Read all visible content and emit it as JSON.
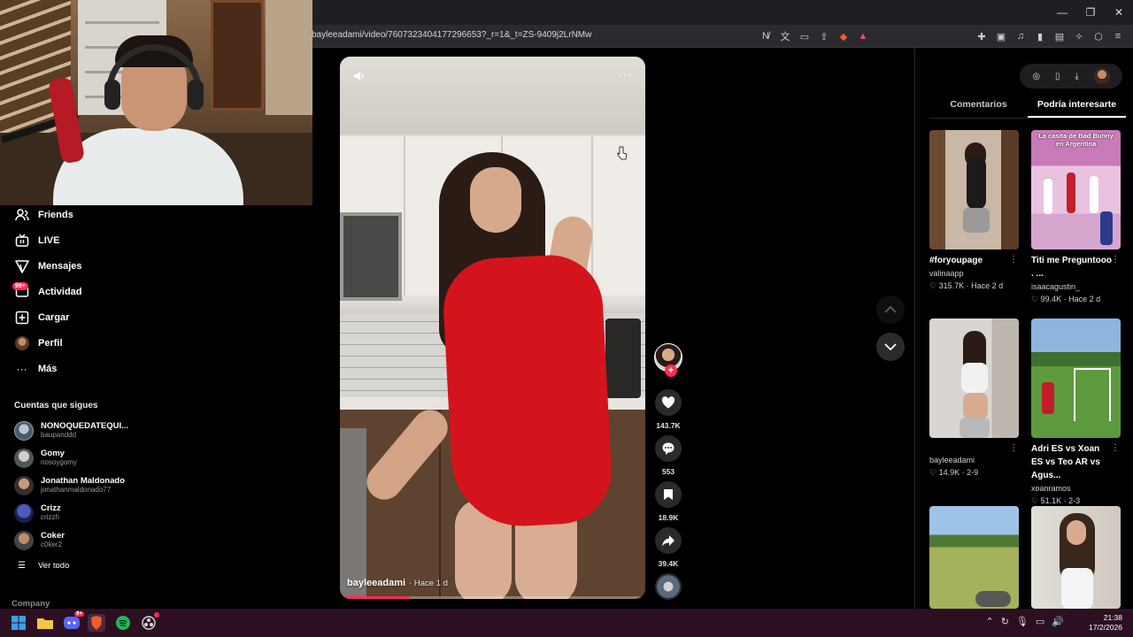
{
  "browser": {
    "url": "bayleeadami/video/7607323404177296653?_r=1&_t=ZS-9409j2LrNMw",
    "window_controls": [
      "—",
      "❐",
      "✕"
    ]
  },
  "sidebar": {
    "items": [
      {
        "label": "Friends",
        "icon": "friends-icon"
      },
      {
        "label": "LIVE",
        "icon": "live-icon"
      },
      {
        "label": "Mensajes",
        "icon": "messages-icon"
      },
      {
        "label": "Actividad",
        "icon": "activity-icon"
      },
      {
        "label": "Cargar",
        "icon": "upload-icon"
      },
      {
        "label": "Perfil",
        "icon": "profile-avatar"
      },
      {
        "label": "Más",
        "icon": "more-icon"
      }
    ],
    "activity_badge": "99+",
    "following_title": "Cuentas que sigues",
    "following": [
      {
        "name": "NONOQUEDATEQUI...",
        "handle": "baupanddd"
      },
      {
        "name": "Gomy",
        "handle": "nosoygomy"
      },
      {
        "name": "Jonathan Maldonado",
        "handle": "jonathanmaldonado77"
      },
      {
        "name": "Crizz",
        "handle": "crizzh"
      },
      {
        "name": "Coker",
        "handle": "c0ker2"
      }
    ],
    "see_all": "Ver todo",
    "company": "Company"
  },
  "video": {
    "username": "bayleeadami",
    "time": "· Hace 1 d",
    "progress_fraction": 0.23
  },
  "actions": {
    "likes": "143.7K",
    "comments": "553",
    "saves": "18.9K",
    "shares": "39.4K"
  },
  "right_panel": {
    "tabs": [
      "Comentarios",
      "Podría interesarte"
    ],
    "active_tab": "Podría interesarte",
    "cards": [
      {
        "title": "#foryoupage",
        "author": "valinaapp",
        "stats": "♡ 315.7K · Hace 2 d",
        "overlay": ""
      },
      {
        "title": "Titi me Preguntooo . ...",
        "author": "isaacagustin_",
        "stats": "♡ 99.4K · Hace 2 d",
        "overlay": "La casita de Bad Bunny en Argentina"
      },
      {
        "title": "",
        "author": "bayleeadami",
        "stats": "♡ 14.9K · 2-9",
        "overlay": ""
      },
      {
        "title": "Adri ES vs Xoan ES vs Teo AR vs Agus...",
        "author": "xoanramos",
        "stats": "♡ 51.1K · 2-3",
        "overlay": ""
      },
      {
        "title": "",
        "author": "",
        "stats": "",
        "overlay": ""
      },
      {
        "title": "",
        "author": "",
        "stats": "",
        "overlay": ""
      }
    ]
  },
  "taskbar": {
    "time": "21:38",
    "date": "17/2/2026",
    "discord_badge": "9+"
  },
  "colors": {
    "accent": "#fe2c55",
    "taskbar": "#2d0f22"
  }
}
